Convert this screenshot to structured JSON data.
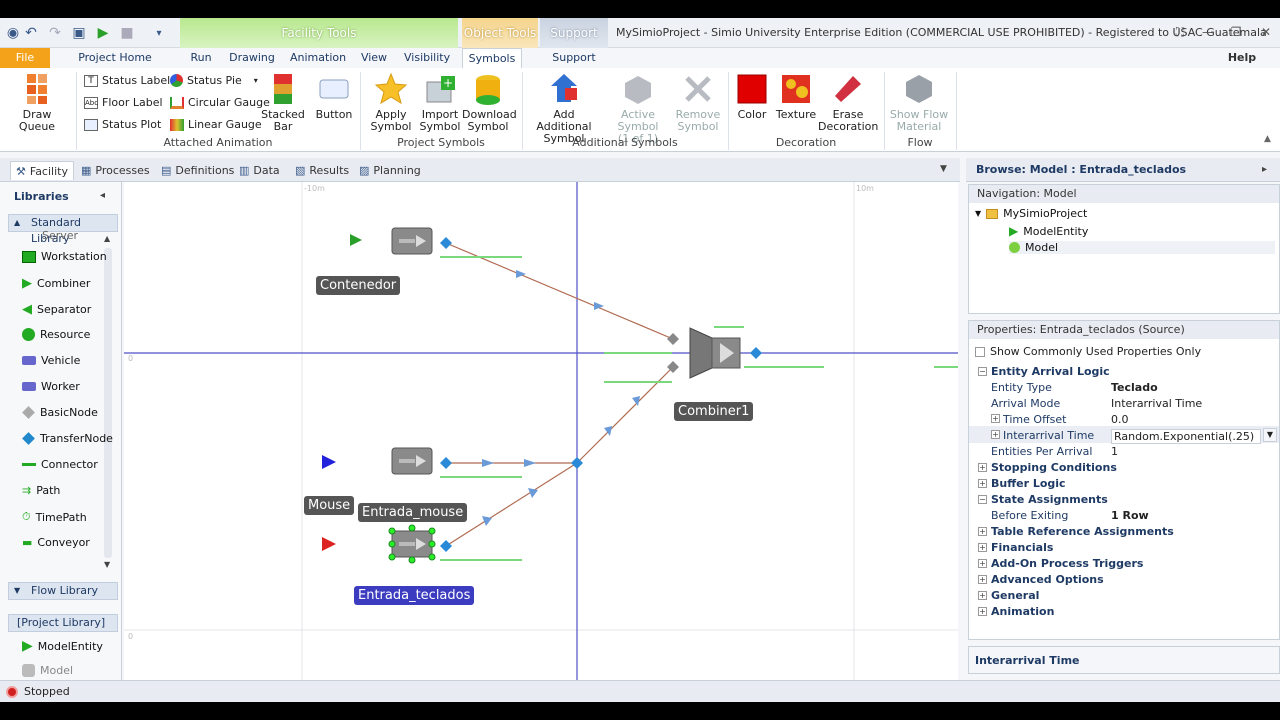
{
  "window": {
    "title": "MySimioProject - Simio University Enterprise Edition (COMMERCIAL USE PROHIBITED) - Registered to USAC Guatemala",
    "context_tabs": {
      "facility_tools": "Facility Tools",
      "object_tools": "Object Tools",
      "support": "Support"
    },
    "help": "Help"
  },
  "tabs": [
    "File",
    "Project Home",
    "Run",
    "Drawing",
    "Animation",
    "View",
    "Visibility",
    "Symbols",
    "Support"
  ],
  "ribbon": {
    "draw_queue": "Draw Queue",
    "status_label": "Status Label",
    "floor_label": "Floor Label",
    "status_plot": "Status Plot",
    "status_pie": "Status Pie",
    "circular_gauge": "Circular Gauge",
    "linear_gauge": "Linear Gauge",
    "stacked_bar_1": "Stacked",
    "stacked_bar_2": "Bar",
    "button": "Button",
    "group_attached": "Attached Animation",
    "apply_symbol_1": "Apply",
    "apply_symbol_2": "Symbol",
    "import_symbol_1": "Import",
    "import_symbol_2": "Symbol",
    "download_symbol_1": "Download",
    "download_symbol_2": "Symbol",
    "group_project_symbols": "Project Symbols",
    "add_additional_1": "Add Additional",
    "add_additional_2": "Symbol",
    "active_symbol_1": "Active Symbol",
    "active_symbol_2": "(1 of 1)",
    "remove_symbol_1": "Remove",
    "remove_symbol_2": "Symbol",
    "group_additional": "Additional Symbols",
    "color": "Color",
    "texture": "Texture",
    "erase_decoration_1": "Erase",
    "erase_decoration_2": "Decoration",
    "group_decoration": "Decoration",
    "show_flow_1": "Show Flow",
    "show_flow_2": "Material",
    "group_flow": "Flow"
  },
  "subtabs": [
    "Facility",
    "Processes",
    "Definitions",
    "Data",
    "Results",
    "Planning"
  ],
  "libraries": {
    "title": "Libraries",
    "standard": "Standard Library",
    "partial": "Server",
    "items": [
      "Workstation",
      "Combiner",
      "Separator",
      "Resource",
      "Vehicle",
      "Worker",
      "BasicNode",
      "TransferNode",
      "Connector",
      "Path",
      "TimePath",
      "Conveyor"
    ],
    "flow": "Flow Library",
    "project": "[Project Library]",
    "project_items": [
      "ModelEntity",
      "Model"
    ]
  },
  "canvas": {
    "ruler": [
      "-10m",
      "0",
      "10m",
      "0"
    ],
    "objects": {
      "contenedor": "Contenedor",
      "combiner": "Combiner1",
      "mouse": "Mouse",
      "entrada_mouse": "Entrada_mouse",
      "entrada_teclados": "Entrada_teclados"
    }
  },
  "browse": {
    "title": "Browse: Model : Entrada_teclados",
    "nav_header": "Navigation: Model",
    "tree": [
      "MySimioProject",
      "ModelEntity",
      "Model"
    ]
  },
  "properties": {
    "header": "Properties: Entrada_teclados (Source)",
    "show_common": "Show Commonly Used Properties Only",
    "entity_arrival_logic": "Entity Arrival Logic",
    "rows": [
      {
        "name": "Entity Type",
        "value": "Teclado"
      },
      {
        "name": "Arrival Mode",
        "value": "Interarrival Time"
      },
      {
        "name": "Time Offset",
        "value": "0.0"
      },
      {
        "name": "Interarrival Time",
        "value": "Random.Exponential(.25)"
      },
      {
        "name": "Entities Per Arrival",
        "value": "1"
      }
    ],
    "stopping": "Stopping Conditions",
    "buffer": "Buffer Logic",
    "state_assign": "State Assignments",
    "before_exiting": "Before Exiting",
    "before_exiting_value": "1 Row",
    "table_ref": "Table Reference Assignments",
    "financials": "Financials",
    "addon": "Add-On Process Triggers",
    "advanced": "Advanced Options",
    "general": "General",
    "animation": "Animation",
    "help_title": "Interarrival Time"
  },
  "status": {
    "text": "Stopped"
  },
  "colors": {
    "accent": "#f4a21a",
    "selection": "#3c3cc0",
    "entity_green": "#2aa02a",
    "entity_blue": "#2222dd",
    "entity_red": "#dd2222"
  }
}
